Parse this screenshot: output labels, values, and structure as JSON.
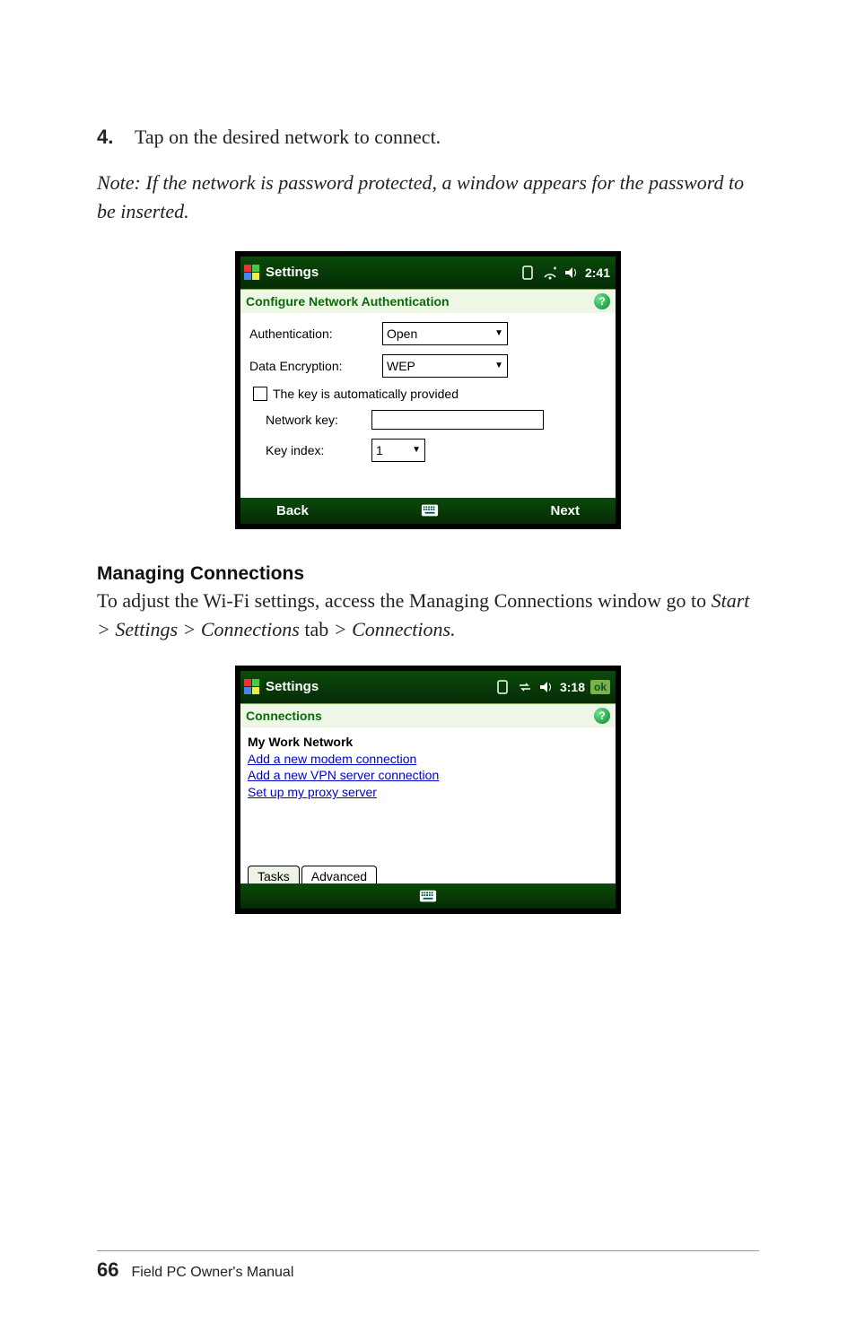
{
  "step": {
    "number": "4.",
    "text": "Tap on the desired network to connect."
  },
  "note": "Note: If the network is password protected, a window appears for the password to be inserted.",
  "screenshot1": {
    "title": "Settings",
    "time": "2:41",
    "panel_title": "Configure Network Authentication",
    "help": "?",
    "fields": {
      "auth_label": "Authentication:",
      "auth_value": "Open",
      "enc_label": "Data Encryption:",
      "enc_value": "WEP",
      "auto_key_label": "The key is automatically provided",
      "netkey_label": "Network key:",
      "keyidx_label": "Key index:",
      "keyidx_value": "1"
    },
    "back": "Back",
    "next": "Next"
  },
  "section": {
    "heading": "Managing Connections",
    "body_pre": "To adjust the Wi-Fi settings, access the Managing Connections window go to ",
    "body_italic": "Start > Settings > Connections",
    "body_mid": " tab ",
    "body_italic2": "> Connections."
  },
  "screenshot2": {
    "title": "Settings",
    "time": "3:18",
    "ok": "ok",
    "panel_title": "Connections",
    "help": "?",
    "group_title": "My Work Network",
    "links": {
      "modem": "Add a new modem connection",
      "vpn": "Add a new VPN server connection",
      "proxy": "Set up my proxy server"
    },
    "tabs": {
      "tasks": "Tasks",
      "advanced": "Advanced"
    }
  },
  "footer": {
    "page": "66",
    "manual": "Field PC Owner's Manual"
  },
  "chart_data": {
    "type": "table",
    "title": "Configure Network Authentication form values",
    "rows": [
      {
        "field": "Authentication",
        "value": "Open"
      },
      {
        "field": "Data Encryption",
        "value": "WEP"
      },
      {
        "field": "The key is automatically provided",
        "value": "unchecked"
      },
      {
        "field": "Network key",
        "value": ""
      },
      {
        "field": "Key index",
        "value": "1"
      }
    ]
  }
}
